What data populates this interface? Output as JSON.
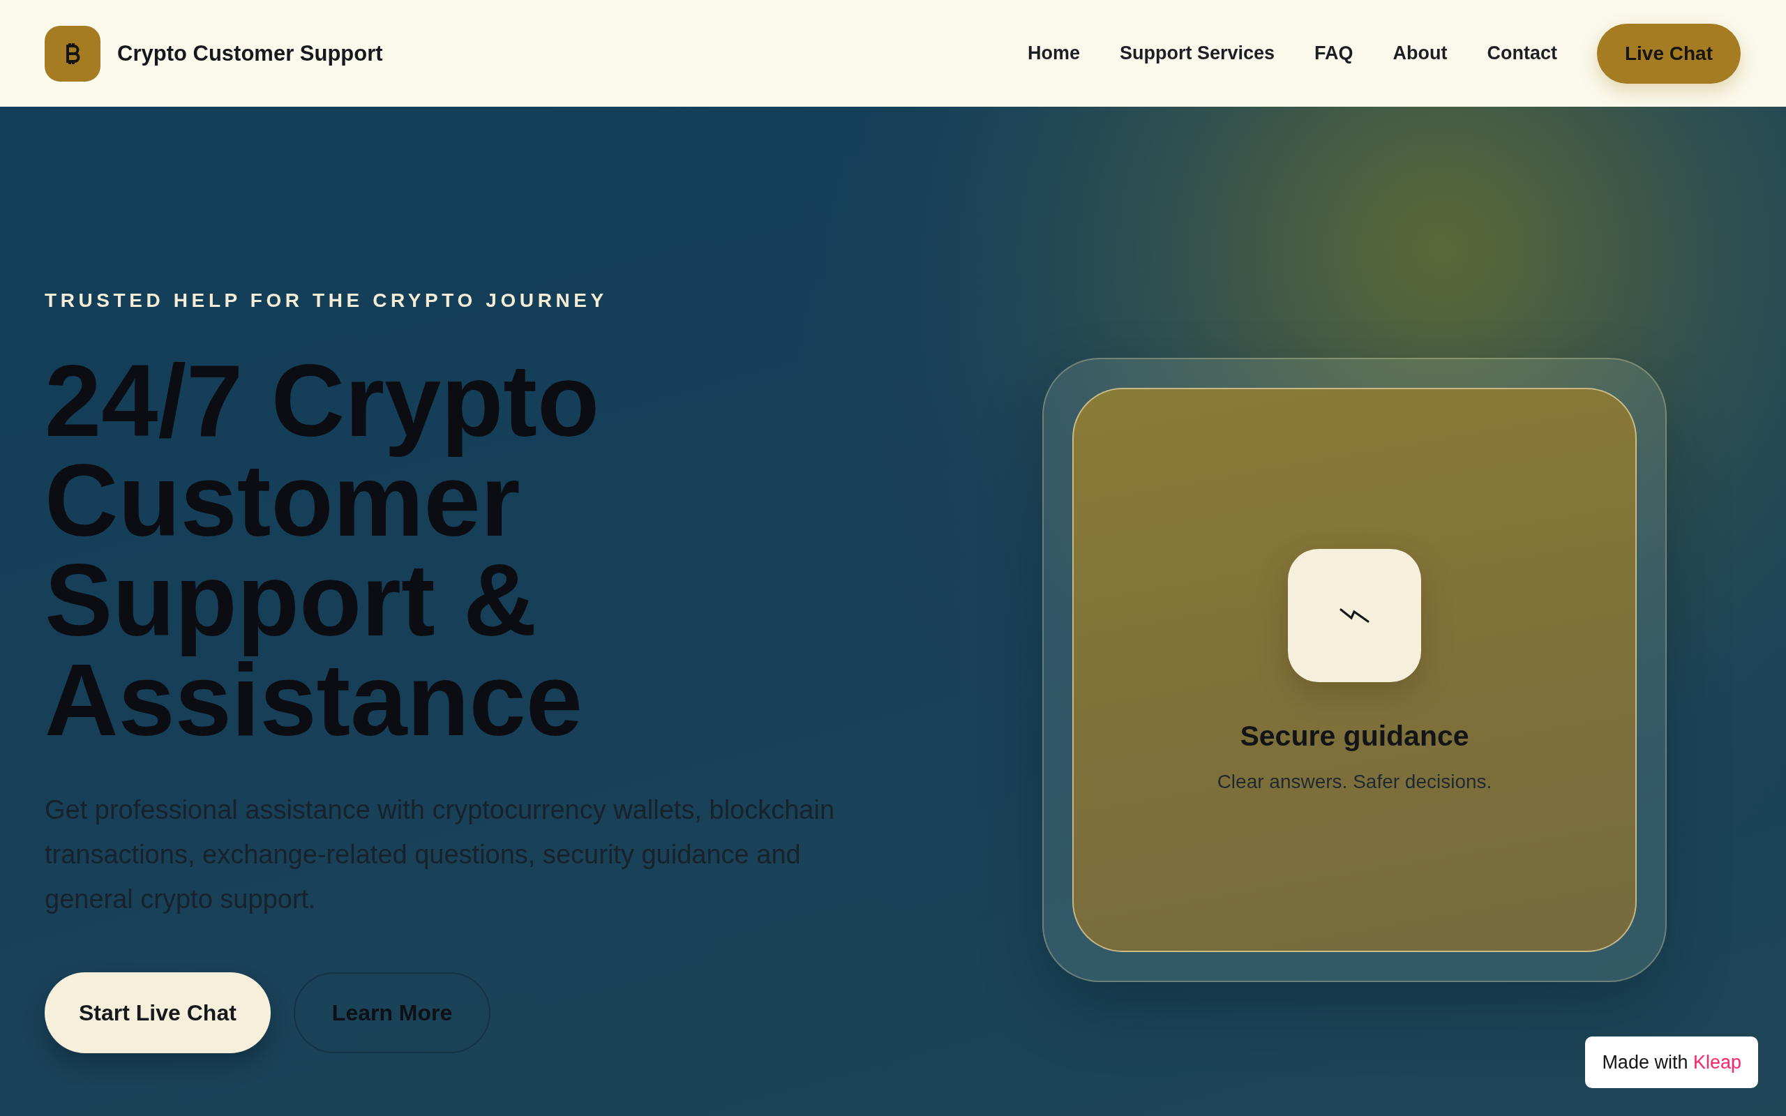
{
  "header": {
    "brand": "Crypto Customer Support",
    "nav": [
      "Home",
      "Support Services",
      "FAQ",
      "About",
      "Contact"
    ],
    "cta": "Live Chat"
  },
  "hero": {
    "eyebrow": "TRUSTED HELP FOR THE CRYPTO JOURNEY",
    "title": "24/7 Crypto Customer Support & Assistance",
    "description": "Get professional assistance with cryptocurrency wallets, blockchain transactions, exchange-related questions, security guidance and general crypto support.",
    "buttons": [
      {
        "label": "Start Live Chat",
        "kind": "primary"
      },
      {
        "label": "Learn More",
        "kind": "secondary"
      }
    ],
    "feature_card": {
      "title": "Secure guidance",
      "subtitle": "Clear answers. Safer decisions."
    }
  },
  "badge": {
    "text": "Made with",
    "brand": "Kleap"
  }
}
